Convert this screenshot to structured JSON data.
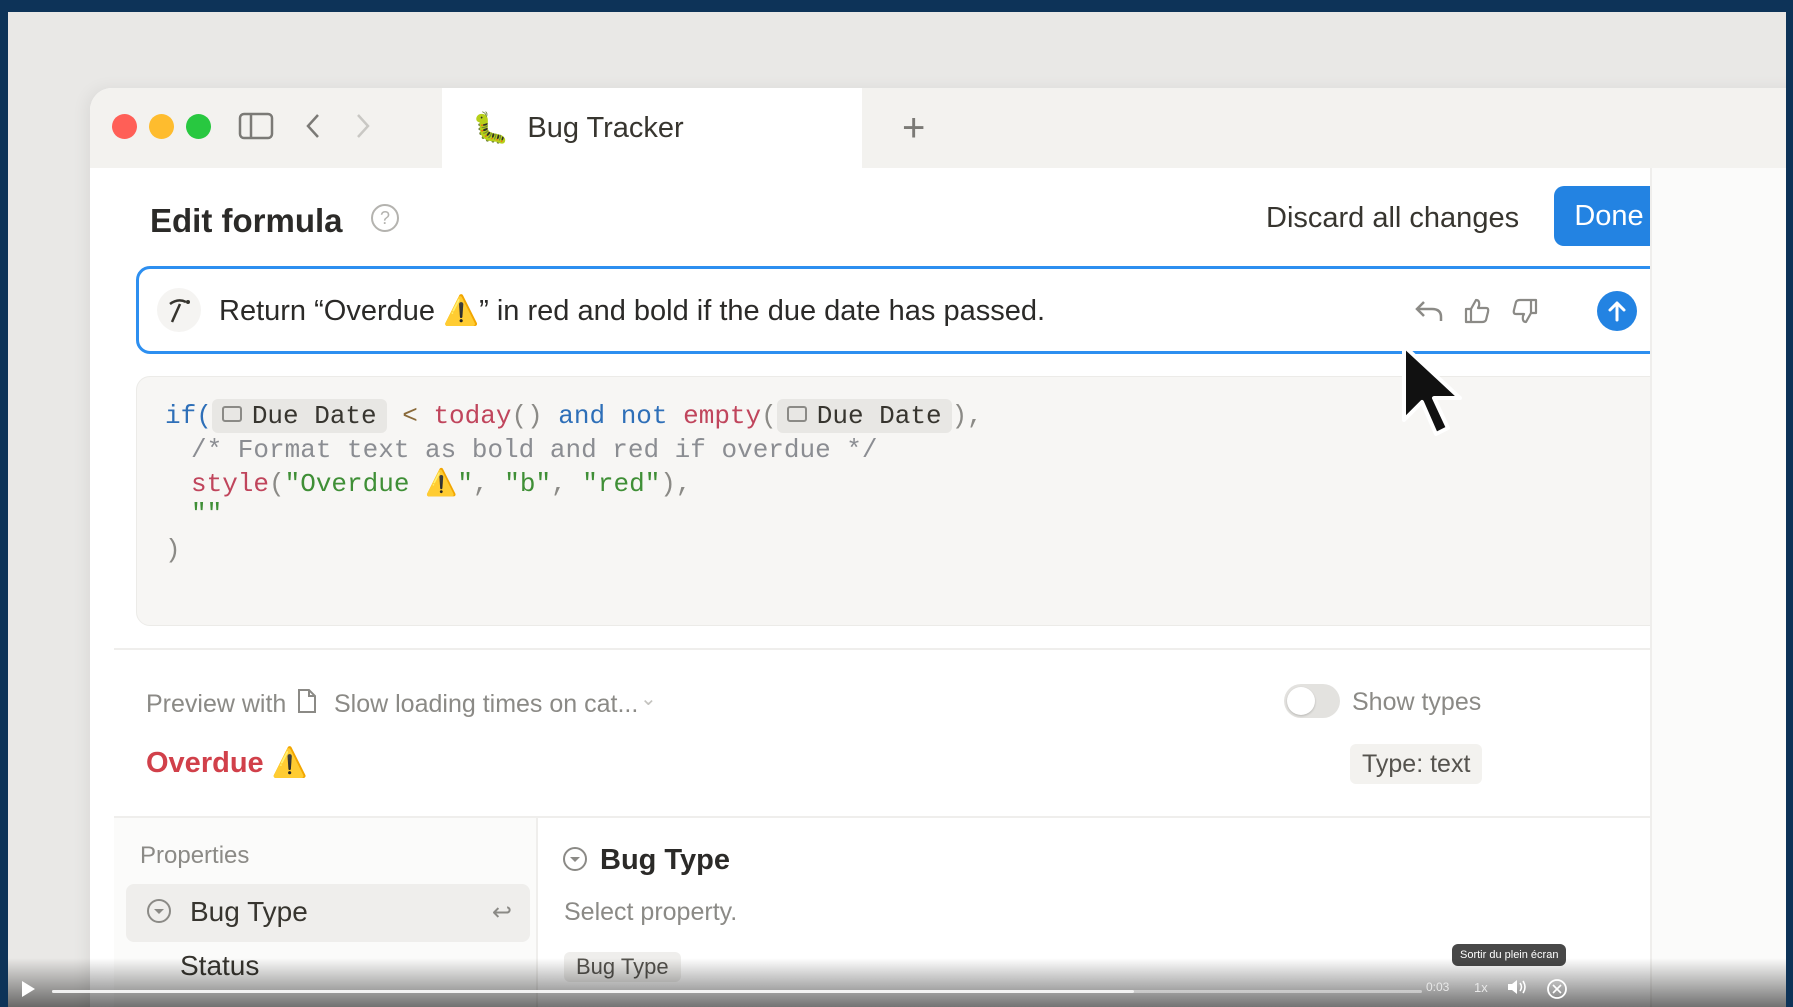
{
  "window": {
    "tab_title": "Bug Tracker",
    "tab_icon": "caterpillar-emoji",
    "colors": {
      "close": "#ff5f57",
      "minimize": "#febc2e",
      "zoom": "#28c840"
    }
  },
  "editor": {
    "title": "Edit formula",
    "discard_label": "Discard all changes",
    "done_label": "Done",
    "accent": "#2383e2"
  },
  "prompt": {
    "text": "Return “Overdue ⚠️” in red and bold if the due date has passed."
  },
  "code": {
    "l1_if": "if(",
    "l1_chip": "Due Date",
    "l1_lt": " < ",
    "l1_today": "today",
    "l1_paren": "() ",
    "l1_and": "and",
    "l1_not": " not ",
    "l1_empty": "empty",
    "l1_open": "(",
    "l1_chip2": "Due Date",
    "l1_close": "),",
    "l2_comment": "/* Format text as bold and red if overdue */",
    "l3_style": "style",
    "l3_open": "(",
    "l3_s1": "\"Overdue ⚠️\"",
    "l3_c1": ", ",
    "l3_s2": "\"b\"",
    "l3_c2": ", ",
    "l3_s3": "\"red\"",
    "l3_close": "),",
    "l4_empty": "\"\"",
    "l5_close": ")"
  },
  "preview": {
    "label": "Preview with",
    "page": "Slow loading times on cat...",
    "show_types_label": "Show types",
    "result": "Overdue ⚠️",
    "type_badge": "Type: text",
    "result_color": "#d1404a"
  },
  "properties": {
    "label": "Properties",
    "items": [
      {
        "label": "Bug Type"
      },
      {
        "label": "Status"
      }
    ]
  },
  "detail": {
    "title": "Bug Type",
    "subtitle": "Select property.",
    "chip": "Bug Type"
  },
  "video": {
    "time": "0:03",
    "speed": "1x",
    "tooltip": "Sortir du plein écran",
    "progress": 0.79
  }
}
